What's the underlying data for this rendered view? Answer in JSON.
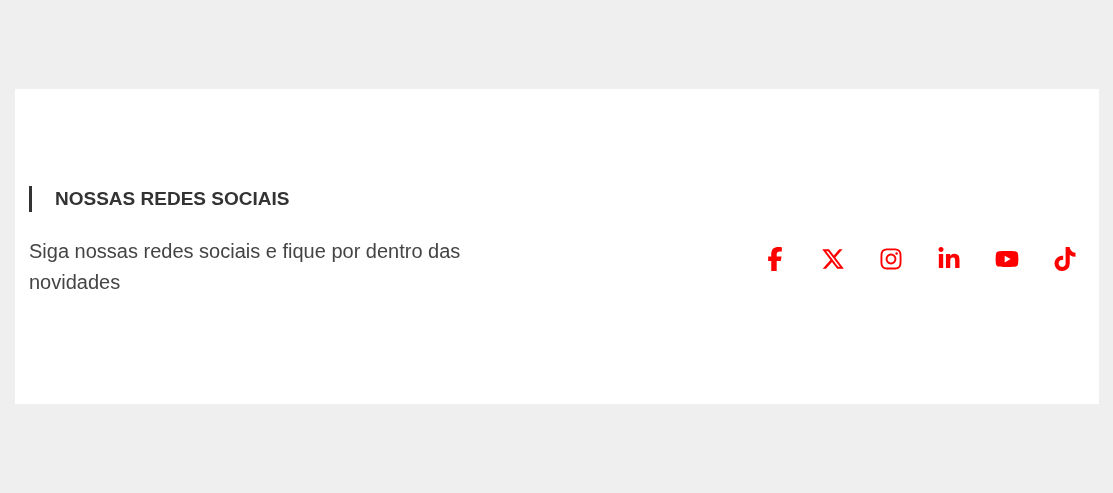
{
  "section": {
    "heading": "NOSSAS REDES SOCIAIS",
    "description": "Siga nossas redes sociais e fique por dentro das novidades",
    "social_links": [
      {
        "kind": "facebook"
      },
      {
        "kind": "x"
      },
      {
        "kind": "instagram"
      },
      {
        "kind": "linkedin"
      },
      {
        "kind": "youtube"
      },
      {
        "kind": "tiktok"
      }
    ]
  }
}
